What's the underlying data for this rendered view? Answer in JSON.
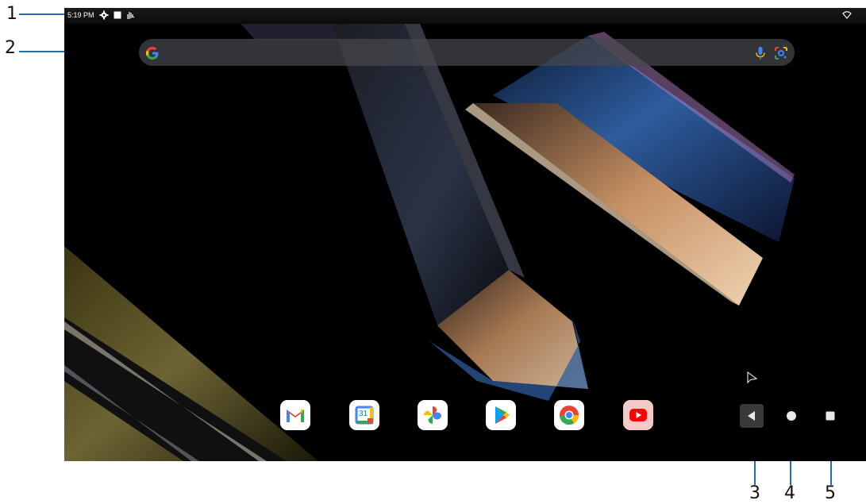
{
  "status_bar": {
    "time": "5:19 PM",
    "icons": [
      "settings-icon",
      "stop-square-icon",
      "hand-gesture-icon",
      "wifi-icon"
    ]
  },
  "search": {
    "placeholder": "",
    "icons": [
      "google-g-icon",
      "microphone-icon",
      "google-lens-icon"
    ]
  },
  "dock": {
    "apps": [
      "gmail-icon",
      "calendar-icon",
      "photos-icon",
      "play-store-icon",
      "chrome-icon",
      "youtube-icon"
    ],
    "calendar_day": "31"
  },
  "nav_bar": {
    "buttons": [
      "back-icon",
      "home-icon",
      "recents-icon"
    ]
  },
  "callouts": {
    "1": "1",
    "2": "2",
    "3": "3",
    "4": "4",
    "5": "5"
  },
  "colors": {
    "callout_line": "#1c6fb5",
    "screen_bg": "#000000"
  }
}
